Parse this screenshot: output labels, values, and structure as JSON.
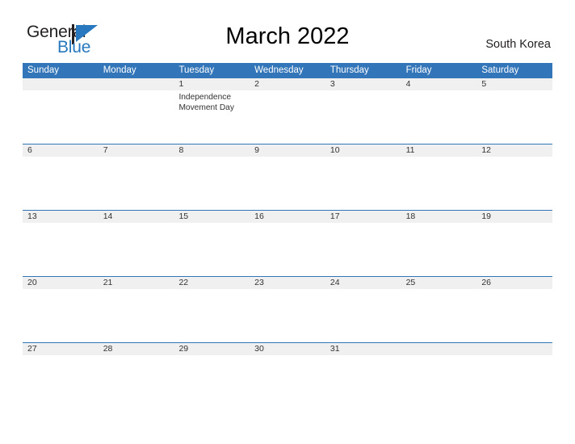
{
  "brand": {
    "name_part1": "General",
    "name_part2": "Blue",
    "flag_icon": "flag-triangle-icon",
    "accent_color": "#2778be"
  },
  "header": {
    "title": "March 2022",
    "region": "South Korea"
  },
  "colors": {
    "header_blue": "#3275b8",
    "number_band_gray": "#f0f0f0",
    "text_dark": "#333333",
    "page_background": "#ffffff"
  },
  "calendar": {
    "month": "March",
    "year": "2022",
    "weekday_headers": [
      "Sunday",
      "Monday",
      "Tuesday",
      "Wednesday",
      "Thursday",
      "Friday",
      "Saturday"
    ],
    "weeks": [
      {
        "days": [
          {
            "number": "",
            "events": []
          },
          {
            "number": "",
            "events": []
          },
          {
            "number": "1",
            "events": [
              "Independence",
              "Movement Day"
            ]
          },
          {
            "number": "2",
            "events": []
          },
          {
            "number": "3",
            "events": []
          },
          {
            "number": "4",
            "events": []
          },
          {
            "number": "5",
            "events": []
          }
        ]
      },
      {
        "days": [
          {
            "number": "6",
            "events": []
          },
          {
            "number": "7",
            "events": []
          },
          {
            "number": "8",
            "events": []
          },
          {
            "number": "9",
            "events": []
          },
          {
            "number": "10",
            "events": []
          },
          {
            "number": "11",
            "events": []
          },
          {
            "number": "12",
            "events": []
          }
        ]
      },
      {
        "days": [
          {
            "number": "13",
            "events": []
          },
          {
            "number": "14",
            "events": []
          },
          {
            "number": "15",
            "events": []
          },
          {
            "number": "16",
            "events": []
          },
          {
            "number": "17",
            "events": []
          },
          {
            "number": "18",
            "events": []
          },
          {
            "number": "19",
            "events": []
          }
        ]
      },
      {
        "days": [
          {
            "number": "20",
            "events": []
          },
          {
            "number": "21",
            "events": []
          },
          {
            "number": "22",
            "events": []
          },
          {
            "number": "23",
            "events": []
          },
          {
            "number": "24",
            "events": []
          },
          {
            "number": "25",
            "events": []
          },
          {
            "number": "26",
            "events": []
          }
        ]
      },
      {
        "days": [
          {
            "number": "27",
            "events": []
          },
          {
            "number": "28",
            "events": []
          },
          {
            "number": "29",
            "events": []
          },
          {
            "number": "30",
            "events": []
          },
          {
            "number": "31",
            "events": []
          },
          {
            "number": "",
            "events": []
          },
          {
            "number": "",
            "events": []
          }
        ]
      }
    ]
  }
}
